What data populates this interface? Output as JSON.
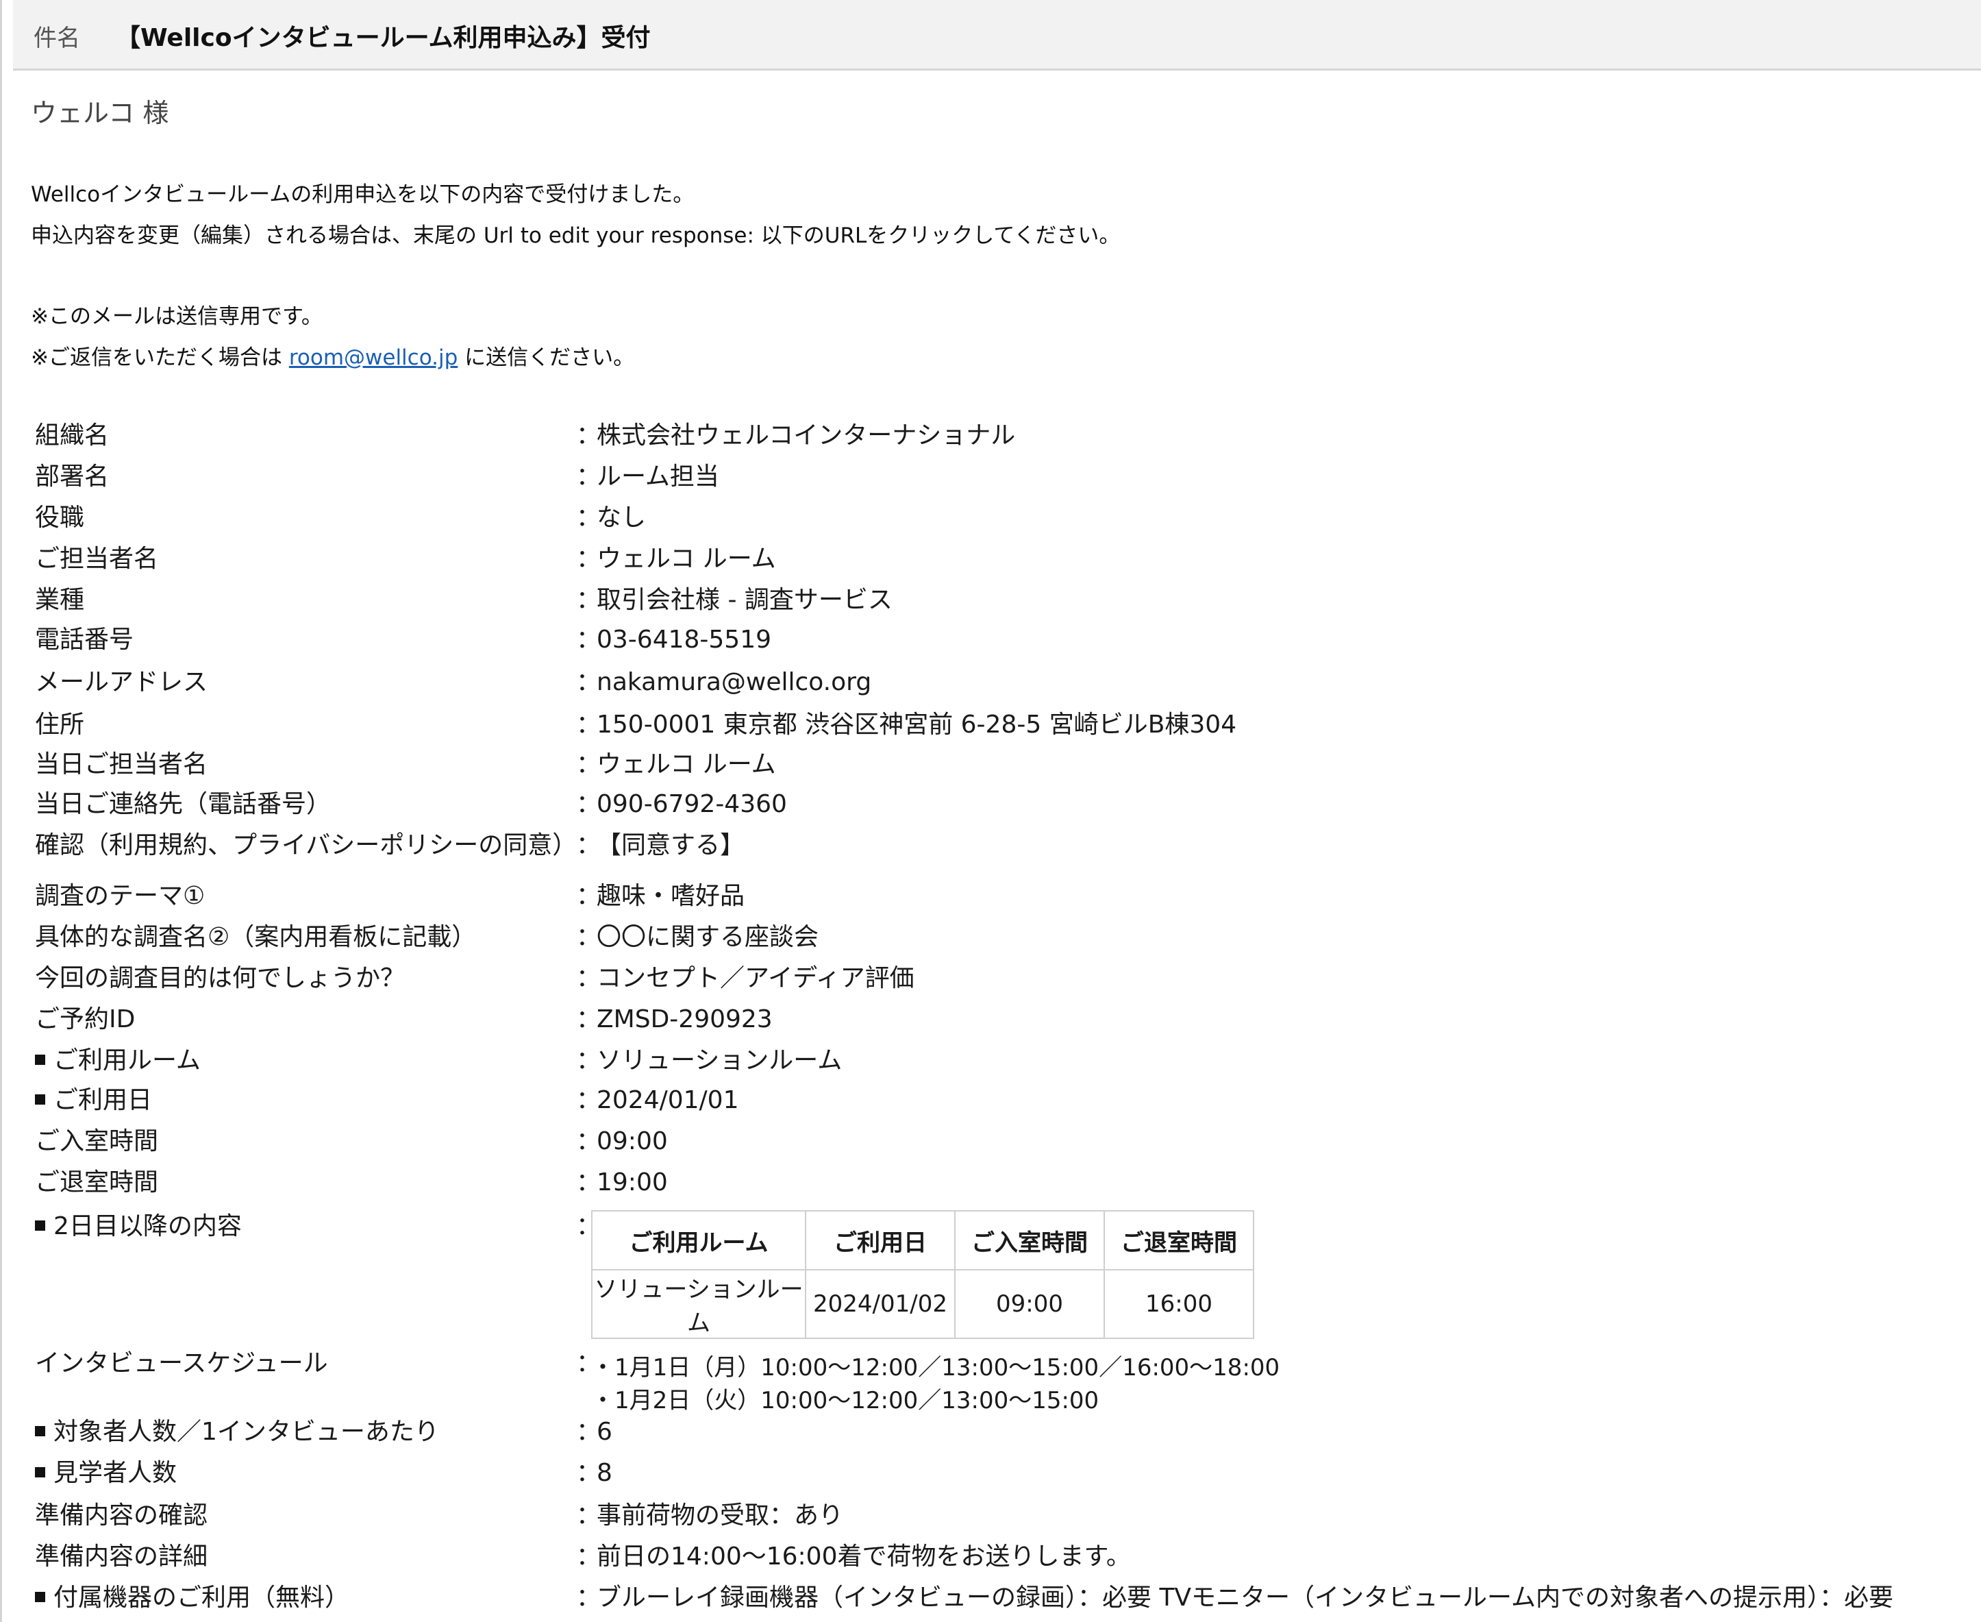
{
  "subject": {
    "label": "件名",
    "text": "【Wellcoインタビュールーム利用申込み】受付"
  },
  "greeting": "ウェルコ 様",
  "intro": {
    "line1": "Wellcoインタビュールームの利用申込を以下の内容で受付けました。",
    "line2": "申込内容を変更（編集）される場合は、末尾の Url to edit your response: 以下のURLをクリックしてください。",
    "line3": "※このメールは送信専用です。",
    "line4_prefix": "※ご返信をいただく場合は ",
    "line4_link": "room@wellco.jp",
    "line4_suffix": " に送信ください。"
  },
  "separator": "：",
  "fields": [
    {
      "label": "組織名",
      "value": "株式会社ウェルコインターナショナル",
      "bullet": false
    },
    {
      "label": "部署名",
      "value": "ルーム担当",
      "bullet": false
    },
    {
      "label": "役職",
      "value": "なし",
      "bullet": false
    },
    {
      "label": "ご担当者名",
      "value": "ウェルコ ルーム",
      "bullet": false
    },
    {
      "label": "業種",
      "value": "取引会社様 - 調査サービス",
      "bullet": false
    },
    {
      "label": "電話番号",
      "value": "03-6418-5519",
      "bullet": false
    },
    {
      "label": "メールアドレス",
      "value": "nakamura@wellco.org",
      "bullet": false
    },
    {
      "label": "住所",
      "value": "150-0001 東京都 渋谷区神宮前 6-28-5 宮崎ビルB棟304",
      "bullet": false
    },
    {
      "label": "当日ご担当者名",
      "value": "ウェルコ ルーム",
      "bullet": false
    },
    {
      "label": "当日ご連絡先（電話番号）",
      "value": "090-6792-4360",
      "bullet": false
    },
    {
      "label": "確認（利用規約、プライバシーポリシーの同意）",
      "value": "【同意する】",
      "bullet": false
    },
    {
      "label": "調査のテーマ①",
      "value": "趣味・嗜好品",
      "bullet": false
    },
    {
      "label": "具体的な調査名②（案内用看板に記載）",
      "value": "〇〇に関する座談会",
      "bullet": false
    },
    {
      "label": "今回の調査目的は何でしょうか？",
      "value": "コンセプト／アイディア評価",
      "bullet": false
    },
    {
      "label": "ご予約ID",
      "value": "ZMSD-290923",
      "bullet": false
    },
    {
      "label": "ご利用ルーム",
      "value": "ソリューションルーム",
      "bullet": true
    },
    {
      "label": "ご利用日",
      "value": "2024/01/01",
      "bullet": true
    },
    {
      "label": "ご入室時間",
      "value": "09:00",
      "bullet": false
    },
    {
      "label": "ご退室時間",
      "value": "19:00",
      "bullet": false
    },
    {
      "label": "2日目以降の内容",
      "value": "",
      "bullet": true
    }
  ],
  "day_table": {
    "headers": [
      "ご利用ルーム",
      "ご利用日",
      "ご入室時間",
      "ご退室時間"
    ],
    "rows": [
      [
        "ソリューションルーム",
        "2024/01/02",
        "09:00",
        "16:00"
      ]
    ]
  },
  "schedule": {
    "label": "インタビュースケジュール",
    "lines": [
      "・1月1日（月）10:00〜12:00／13:00〜15:00／16:00〜18:00",
      "・1月2日（火）10:00〜12:00／13:00〜15:00"
    ]
  },
  "fields2": [
    {
      "label": "対象者人数／1インタビューあたり",
      "value": "6",
      "bullet": true
    },
    {
      "label": "見学者人数",
      "value": "8",
      "bullet": true
    },
    {
      "label": "準備内容の確認",
      "value": "事前荷物の受取：あり",
      "bullet": false
    },
    {
      "label": "準備内容の詳細",
      "value": "前日の14:00〜16:00着で荷物をお送りします。",
      "bullet": false
    },
    {
      "label": "付属機器のご利用（無料）",
      "value": "ブルーレイ録画機器（インタビューの録画）：必要  TVモニター（インタビュールーム内での対象者への提示用）：必要",
      "bullet": true
    }
  ]
}
